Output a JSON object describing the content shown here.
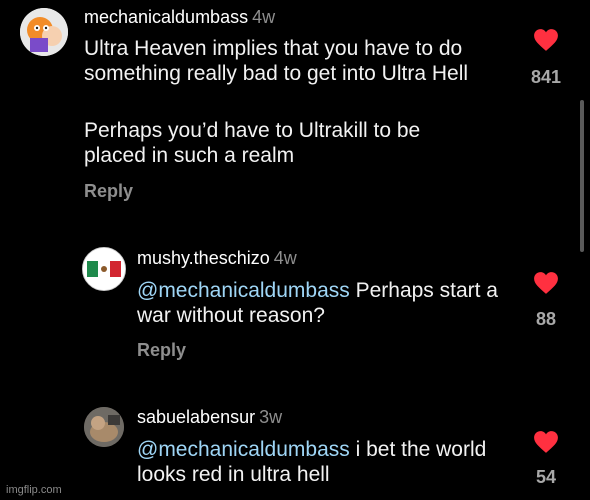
{
  "comments": [
    {
      "username": "mechanicaldumbass",
      "time": "4w",
      "paragraphs": [
        "Ultra Heaven implies that you have to do something really bad to get into Ultra Hell",
        "Perhaps you’d have to Ultrakill to be placed in such a realm"
      ],
      "reply_label": "Reply",
      "likes": "841",
      "liked": true
    },
    {
      "username": "mushy.theschizo",
      "time": "4w",
      "mention": "@mechanicaldumbass",
      "text": " Perhaps start a war without reason?",
      "reply_label": "Reply",
      "likes": "88",
      "liked": true
    },
    {
      "username": "sabuelabensur",
      "time": "3w",
      "mention": "@mechanicaldumbass",
      "text": " i bet the world looks red in ultra hell",
      "likes": "54",
      "liked": true
    }
  ],
  "watermark": "imgflip.com",
  "colors": {
    "background": "#000000",
    "heart": "#ff3040",
    "mention": "#9fd6f6",
    "muted": "#8e8e8e"
  }
}
